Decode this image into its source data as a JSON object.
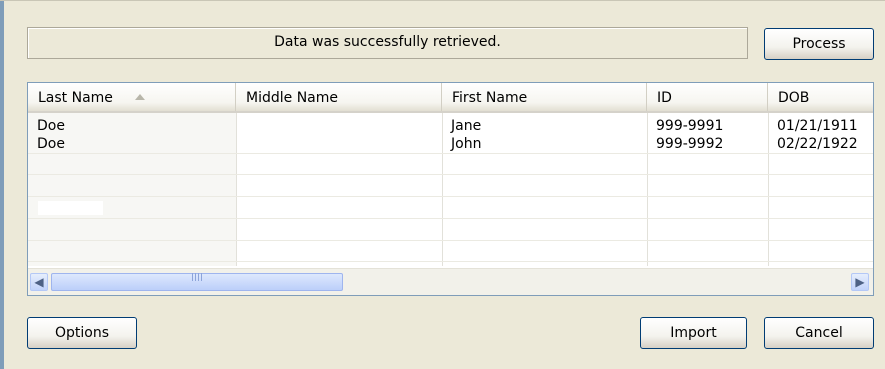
{
  "status": {
    "message": "Data was successfully retrieved."
  },
  "buttons": {
    "process": "Process",
    "options": "Options",
    "import": "Import",
    "cancel": "Cancel"
  },
  "grid": {
    "columns": [
      "Last Name",
      "Middle Name",
      "First Name",
      "ID",
      "DOB"
    ],
    "sort": {
      "column": "Last Name",
      "direction": "ascending"
    },
    "rows": [
      {
        "last_name": "Doe",
        "middle_name": "",
        "first_name": "Jane",
        "id": "999-9991",
        "dob": "01/21/1911"
      },
      {
        "last_name": "Doe",
        "middle_name": "",
        "first_name": "John",
        "id": "999-9992",
        "dob": "02/22/1922"
      }
    ]
  },
  "icons": {
    "sort": "sort-ascending-icon",
    "scroll_left": "arrow-left-icon",
    "scroll_right": "arrow-right-icon"
  },
  "colors": {
    "dialog_bg": "#ece9d8",
    "button_border": "#003c74",
    "grid_border": "#7f9db9",
    "scrollbar_accent": "#c1d3fb"
  }
}
